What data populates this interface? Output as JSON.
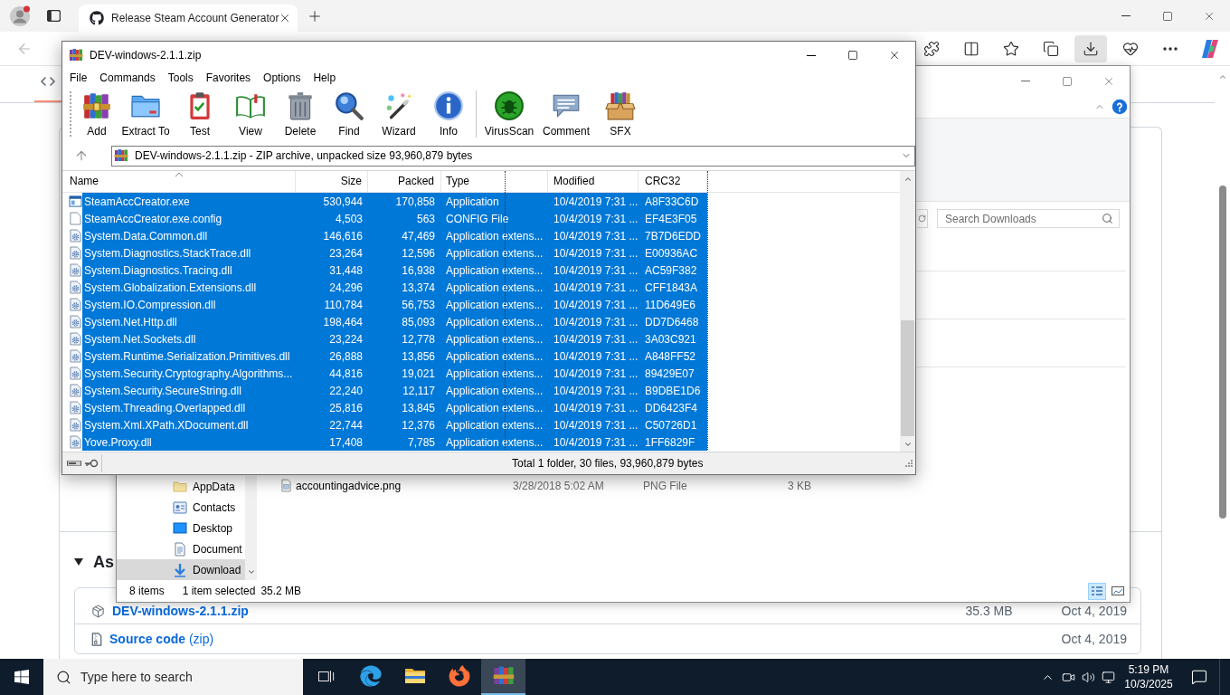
{
  "browser": {
    "tabs": [
      {
        "title": "Release Steam Account Generator",
        "selected": true
      }
    ],
    "back": {
      "disabled": true
    },
    "toolbar": [
      {
        "kind": "extensions",
        "selected": false
      },
      {
        "kind": "split_screen",
        "selected": false
      },
      {
        "kind": "favorites",
        "selected": false
      },
      {
        "kind": "collections",
        "selected": false
      },
      {
        "kind": "downloads",
        "selected": true
      },
      {
        "kind": "essentials",
        "selected": false
      },
      {
        "kind": "more",
        "selected": false
      },
      {
        "kind": "copilot",
        "selected": false
      }
    ],
    "page": {
      "repo_tabs": [
        {
          "kind": "code",
          "selected": true
        }
      ],
      "assets_heading": {
        "text": "As",
        "expanded": true
      },
      "assets": [
        {
          "kind": "package",
          "name": "DEV-windows-2.1.1.zip",
          "size": "35.3 MB",
          "date": "Oct 4, 2019"
        },
        {
          "kind": "source",
          "name": "Source code",
          "suffix": "(zip)",
          "date": "Oct 4, 2019"
        }
      ]
    }
  },
  "explorer": {
    "search": {
      "placeholder": "Search Downloads"
    },
    "nav": [
      {
        "label": "AppData",
        "kind": "folder",
        "selected": false
      },
      {
        "label": "Contacts",
        "kind": "contacts",
        "selected": false
      },
      {
        "label": "Desktop",
        "kind": "desktop",
        "selected": false
      },
      {
        "label": "Document",
        "kind": "documents",
        "selected": false
      },
      {
        "label": "Download",
        "kind": "downloads",
        "selected": true
      }
    ],
    "files": [
      {
        "kind": "image",
        "name": "accountingadvice.png",
        "modified": "3/28/2018 5:02 AM",
        "type": "PNG File",
        "size": "3 KB"
      }
    ],
    "status": {
      "items": "8 items",
      "selected": "1 item selected",
      "selected_size": "35.2 MB"
    },
    "views": [
      {
        "kind": "details",
        "selected": true
      },
      {
        "kind": "large_icons",
        "selected": false
      }
    ]
  },
  "winrar": {
    "title": "DEV-windows-2.1.1.zip",
    "menu": [
      "File",
      "Commands",
      "Tools",
      "Favorites",
      "Options",
      "Help"
    ],
    "toolbar_groups": [
      {
        "buttons": [
          {
            "kind": "add",
            "label": "Add"
          },
          {
            "kind": "extract",
            "label": "Extract To"
          },
          {
            "kind": "test",
            "label": "Test"
          },
          {
            "kind": "view",
            "label": "View"
          },
          {
            "kind": "delete",
            "label": "Delete"
          },
          {
            "kind": "find",
            "label": "Find"
          },
          {
            "kind": "wizard",
            "label": "Wizard"
          },
          {
            "kind": "info",
            "label": "Info"
          }
        ]
      },
      {
        "buttons": [
          {
            "kind": "virusscan",
            "label": "VirusScan"
          },
          {
            "kind": "comment",
            "label": "Comment"
          },
          {
            "kind": "sfx",
            "label": "SFX"
          }
        ]
      }
    ],
    "path": "DEV-windows-2.1.1.zip - ZIP archive, unpacked size 93,960,879 bytes",
    "columns": [
      {
        "label": "Name",
        "sorted": true
      },
      {
        "label": "Size",
        "sorted": false
      },
      {
        "label": "Packed",
        "sorted": false
      },
      {
        "label": "Type",
        "sorted": false
      },
      {
        "label": "Modified",
        "sorted": false
      },
      {
        "label": "CRC32",
        "sorted": false
      }
    ],
    "rows": [
      {
        "kind": "exe",
        "name": "SteamAccCreator.exe",
        "size": "530,944",
        "packed": "170,858",
        "type": "Application",
        "modified": "10/4/2019 7:31 ...",
        "crc": "A8F33C6D",
        "selected": true
      },
      {
        "kind": "config",
        "name": "SteamAccCreator.exe.config",
        "size": "4,503",
        "packed": "563",
        "type": "CONFIG File",
        "modified": "10/4/2019 7:31 ...",
        "crc": "EF4E3F05",
        "selected": true
      },
      {
        "kind": "dll",
        "name": "System.Data.Common.dll",
        "size": "146,616",
        "packed": "47,469",
        "type": "Application extens...",
        "modified": "10/4/2019 7:31 ...",
        "crc": "7B7D6EDD",
        "selected": true
      },
      {
        "kind": "dll",
        "name": "System.Diagnostics.StackTrace.dll",
        "size": "23,264",
        "packed": "12,596",
        "type": "Application extens...",
        "modified": "10/4/2019 7:31 ...",
        "crc": "E00936AC",
        "selected": true
      },
      {
        "kind": "dll",
        "name": "System.Diagnostics.Tracing.dll",
        "size": "31,448",
        "packed": "16,938",
        "type": "Application extens...",
        "modified": "10/4/2019 7:31 ...",
        "crc": "AC59F382",
        "selected": true
      },
      {
        "kind": "dll",
        "name": "System.Globalization.Extensions.dll",
        "size": "24,296",
        "packed": "13,374",
        "type": "Application extens...",
        "modified": "10/4/2019 7:31 ...",
        "crc": "CFF1843A",
        "selected": true
      },
      {
        "kind": "dll",
        "name": "System.IO.Compression.dll",
        "size": "110,784",
        "packed": "56,753",
        "type": "Application extens...",
        "modified": "10/4/2019 7:31 ...",
        "crc": "11D649E6",
        "selected": true
      },
      {
        "kind": "dll",
        "name": "System.Net.Http.dll",
        "size": "198,464",
        "packed": "85,093",
        "type": "Application extens...",
        "modified": "10/4/2019 7:31 ...",
        "crc": "DD7D6468",
        "selected": true
      },
      {
        "kind": "dll",
        "name": "System.Net.Sockets.dll",
        "size": "23,224",
        "packed": "12,778",
        "type": "Application extens...",
        "modified": "10/4/2019 7:31 ...",
        "crc": "3A03C921",
        "selected": true
      },
      {
        "kind": "dll",
        "name": "System.Runtime.Serialization.Primitives.dll",
        "size": "26,888",
        "packed": "13,856",
        "type": "Application extens...",
        "modified": "10/4/2019 7:31 ...",
        "crc": "A848FF52",
        "selected": true
      },
      {
        "kind": "dll",
        "name": "System.Security.Cryptography.Algorithms...",
        "size": "44,816",
        "packed": "19,021",
        "type": "Application extens...",
        "modified": "10/4/2019 7:31 ...",
        "crc": "89429E07",
        "selected": true
      },
      {
        "kind": "dll",
        "name": "System.Security.SecureString.dll",
        "size": "22,240",
        "packed": "12,117",
        "type": "Application extens...",
        "modified": "10/4/2019 7:31 ...",
        "crc": "B9DBE1D6",
        "selected": true
      },
      {
        "kind": "dll",
        "name": "System.Threading.Overlapped.dll",
        "size": "25,816",
        "packed": "13,845",
        "type": "Application extens...",
        "modified": "10/4/2019 7:31 ...",
        "crc": "DD6423F4",
        "selected": true
      },
      {
        "kind": "dll",
        "name": "System.Xml.XPath.XDocument.dll",
        "size": "22,744",
        "packed": "12,376",
        "type": "Application extens...",
        "modified": "10/4/2019 7:31 ...",
        "crc": "C50726D1",
        "selected": true
      },
      {
        "kind": "dll",
        "name": "Yove.Proxy.dll",
        "size": "17,408",
        "packed": "7,785",
        "type": "Application extens...",
        "modified": "10/4/2019 7:31 ...",
        "crc": "1FF6829F",
        "selected": true
      }
    ],
    "status": "Total 1 folder, 30 files, 93,960,879 bytes"
  },
  "taskbar": {
    "search": {
      "placeholder": "Type here to search"
    },
    "apps": [
      {
        "kind": "task_view",
        "selected": false
      },
      {
        "kind": "edge",
        "selected": false
      },
      {
        "kind": "explorer",
        "selected": false
      },
      {
        "kind": "firefox",
        "selected": false
      },
      {
        "kind": "winrar",
        "selected": true
      }
    ],
    "time": "5:19 PM",
    "date": "10/3/2025"
  }
}
